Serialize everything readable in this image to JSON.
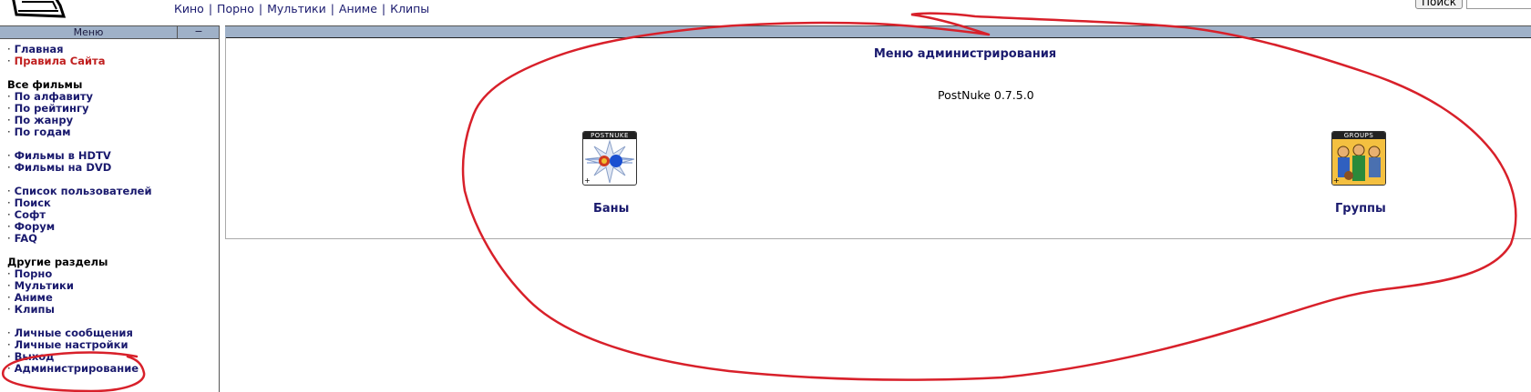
{
  "header": {
    "nav": [
      {
        "label": "Кино"
      },
      {
        "label": "Порно"
      },
      {
        "label": "Мультики"
      },
      {
        "label": "Аниме"
      },
      {
        "label": "Клипы"
      }
    ],
    "separator": "|",
    "search_button": "Поиск"
  },
  "sidebar": {
    "title": "Меню",
    "toggle": "−",
    "bullet": "·",
    "items": [
      {
        "label": "Главная"
      },
      {
        "label": "Правила Сайта"
      },
      {
        "label": "Все фильмы"
      },
      {
        "label": "По алфавиту"
      },
      {
        "label": "По рейтингу"
      },
      {
        "label": "По жанру"
      },
      {
        "label": "По годам"
      },
      {
        "label": "Фильмы в HDTV"
      },
      {
        "label": "Фильмы на DVD"
      },
      {
        "label": "Список пользователей"
      },
      {
        "label": "Поиск"
      },
      {
        "label": "Софт"
      },
      {
        "label": "Форум"
      },
      {
        "label": "FAQ"
      },
      {
        "label": "Другие разделы"
      },
      {
        "label": "Порно"
      },
      {
        "label": "Мультики"
      },
      {
        "label": "Аниме"
      },
      {
        "label": "Клипы"
      },
      {
        "label": "Личные сообщения"
      },
      {
        "label": "Личные настройки"
      },
      {
        "label": "Выход"
      },
      {
        "label": "Администрирование"
      }
    ]
  },
  "main": {
    "title": "Меню администрирования",
    "version": "PostNuke 0.7.5.0",
    "modules": [
      {
        "icon_caption": "POSTNUKE",
        "label": "Баны",
        "icon": "postnuke-bans-icon"
      },
      {
        "icon_caption": "GROUPS",
        "label": "Группы",
        "icon": "groups-icon"
      }
    ]
  },
  "colors": {
    "link": "#1a1a6e",
    "link_red": "#c02020",
    "bar": "#9fb1c8",
    "annotation": "#d8202a"
  }
}
